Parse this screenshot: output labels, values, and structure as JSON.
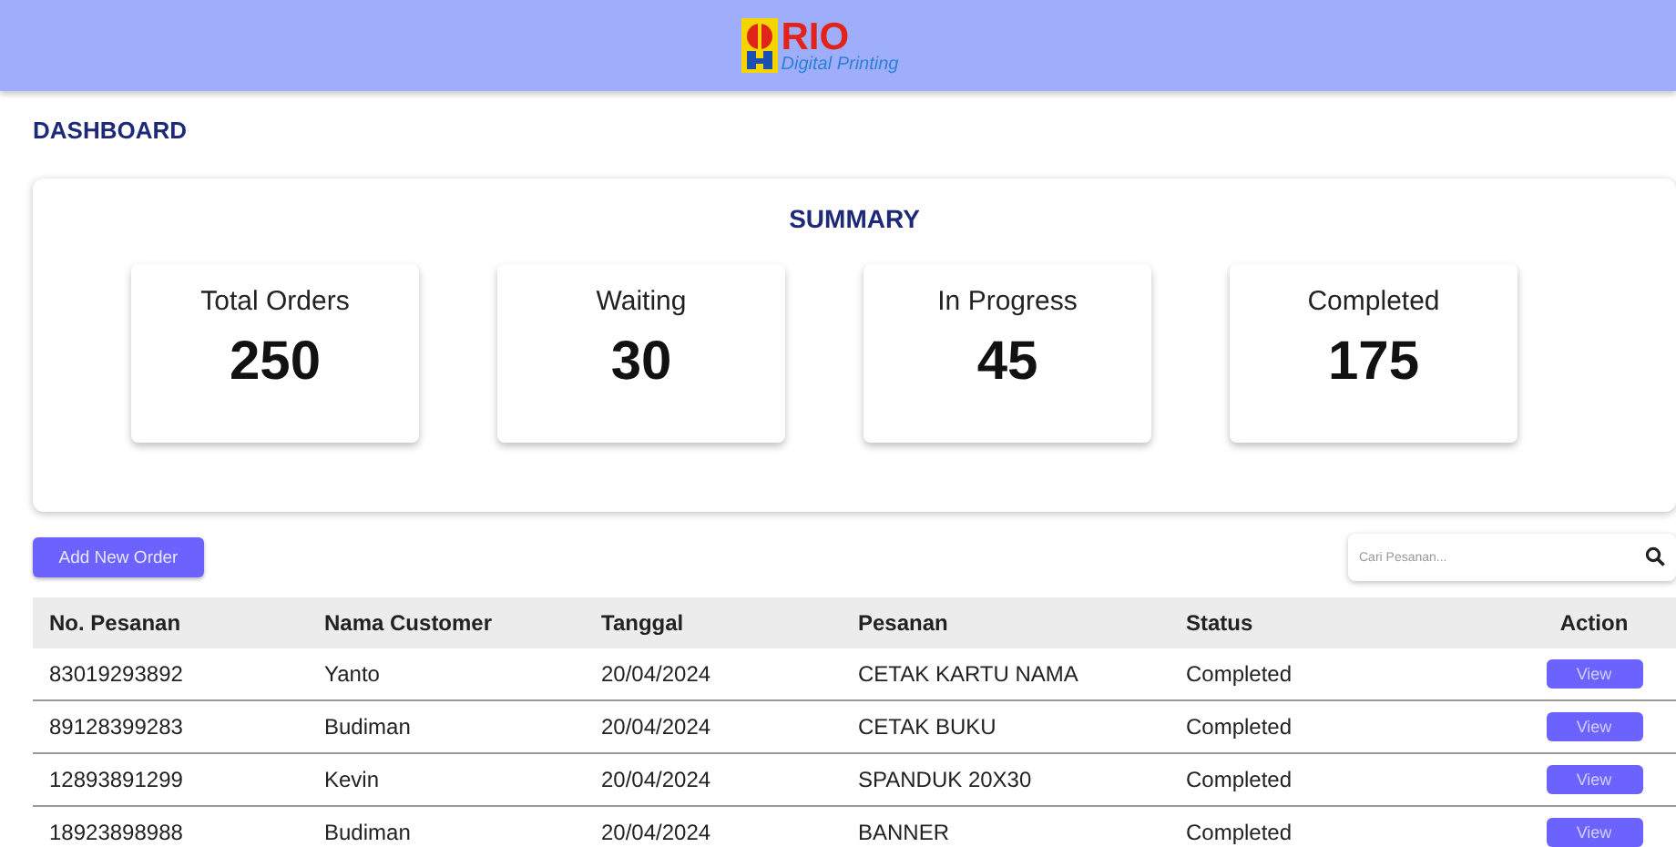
{
  "header": {
    "logo_title": "RIO",
    "logo_subtitle": "Digital Printing"
  },
  "page_title": "DASHBOARD",
  "summary": {
    "title": "SUMMARY",
    "stats": [
      {
        "label": "Total Orders",
        "value": "250"
      },
      {
        "label": "Waiting",
        "value": "30"
      },
      {
        "label": "In Progress",
        "value": "45"
      },
      {
        "label": "Completed",
        "value": "175"
      }
    ]
  },
  "add_button": "Add New Order",
  "search": {
    "placeholder": "Cari Pesanan..."
  },
  "table": {
    "columns": [
      "No. Pesanan",
      "Nama Customer",
      "Tanggal",
      "Pesanan",
      "Status",
      "Action"
    ],
    "rows": [
      {
        "cells": [
          "83019293892",
          "Yanto",
          "20/04/2024",
          "CETAK KARTU NAMA",
          "Completed"
        ],
        "action": "View"
      },
      {
        "cells": [
          "89128399283",
          "Budiman",
          "20/04/2024",
          "CETAK BUKU",
          "Completed"
        ],
        "action": "View"
      },
      {
        "cells": [
          "12893891299",
          "Kevin",
          "20/04/2024",
          "SPANDUK 20X30",
          "Completed"
        ],
        "action": "View"
      },
      {
        "cells": [
          "18923898988",
          "Budiman",
          "20/04/2024",
          "BANNER",
          "Completed"
        ],
        "action": "View"
      }
    ]
  }
}
